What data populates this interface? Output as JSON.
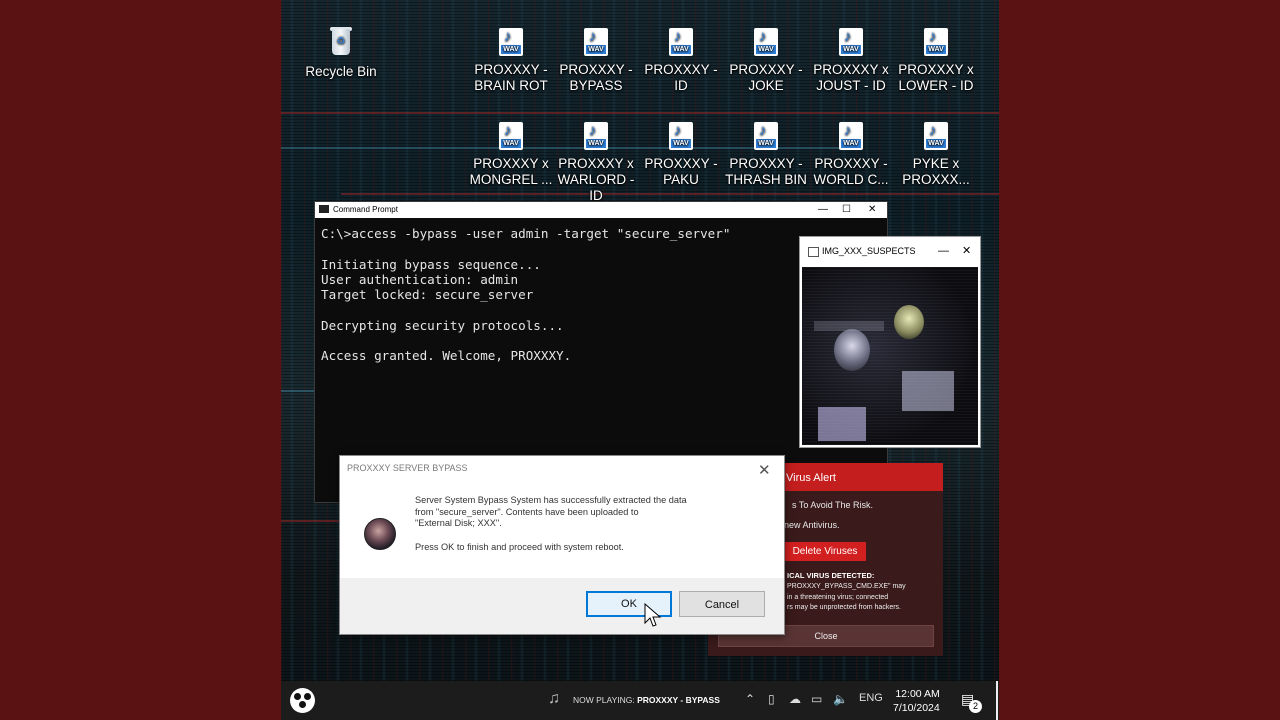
{
  "desktop": {
    "recycle_bin": "Recycle Bin",
    "icons": [
      {
        "label": "PROXXXY - BRAIN ROT",
        "file_badge": "WAV"
      },
      {
        "label": "PROXXXY - BYPASS",
        "file_badge": "WAV"
      },
      {
        "label": "PROXXXY - ID",
        "file_badge": "WAV"
      },
      {
        "label": "PROXXXY - JOKE",
        "file_badge": "WAV"
      },
      {
        "label": "PROXXXY x JOUST - ID",
        "file_badge": "WAV"
      },
      {
        "label": "PROXXXY x LOWER - ID",
        "file_badge": "WAV"
      },
      {
        "label": "PROXXXY x MONGREL ...",
        "file_badge": "WAV"
      },
      {
        "label": "PROXXXY x WARLORD - ID",
        "file_badge": "WAV"
      },
      {
        "label": "PROXXXY - PAKU",
        "file_badge": "WAV"
      },
      {
        "label": "PROXXXY - THRASH BIN",
        "file_badge": "WAV"
      },
      {
        "label": "PROXXXY - WORLD C...",
        "file_badge": "WAV"
      },
      {
        "label": "PYKE x PROXXX...",
        "file_badge": "WAV"
      }
    ]
  },
  "cmd": {
    "title": "Command Prompt",
    "controls": {
      "minimize": "—",
      "maximize": "☐",
      "close": "✕"
    },
    "lines": [
      "C:\\>access -bypass -user admin -target \"secure_server\"",
      "",
      "Initiating bypass sequence...",
      "User authentication: admin",
      "Target locked: secure_server",
      "",
      "Decrypting security protocols...",
      "",
      "Access granted. Welcome, PROXXXY."
    ]
  },
  "image_viewer": {
    "title": "IMG_XXX_SUSPECTS",
    "controls": {
      "minimize": "—",
      "close": "✕"
    }
  },
  "virus_alert": {
    "title": "Virus Alert",
    "line1": "s To Avoid The Risk.",
    "line2": "new Antivirus.",
    "delete_button": "Delete Viruses",
    "critical_heading": "ICAL VIRUS DETECTED:",
    "critical_body": "PROXXXY_BYPASS_CMD.EXE\" may\nin a threatening virus; connected\nrs may be unprotected from hackers.",
    "close_button": "Close"
  },
  "dialog": {
    "title": "PROXXXY SERVER BYPASS",
    "close": "✕",
    "message": "Server System Bypass System has successfully extracted the data\nfrom \"secure_server\". Contents have been uploaded to\n\"External Disk; XXX\".",
    "message2": "Press OK to finish and proceed with system reboot.",
    "ok_label": "OK",
    "cancel_label": "Cancel"
  },
  "taskbar": {
    "now_playing_prefix": "NOW PLAYING: ",
    "now_playing_track": "PROXXXY - BYPASS",
    "language": "ENG",
    "time": "12:00 AM",
    "date": "7/10/2024",
    "notification_count": "2"
  },
  "colors": {
    "frame": "#5a1212",
    "alert_red": "#c41e1e",
    "primary_border": "#0078d7"
  }
}
